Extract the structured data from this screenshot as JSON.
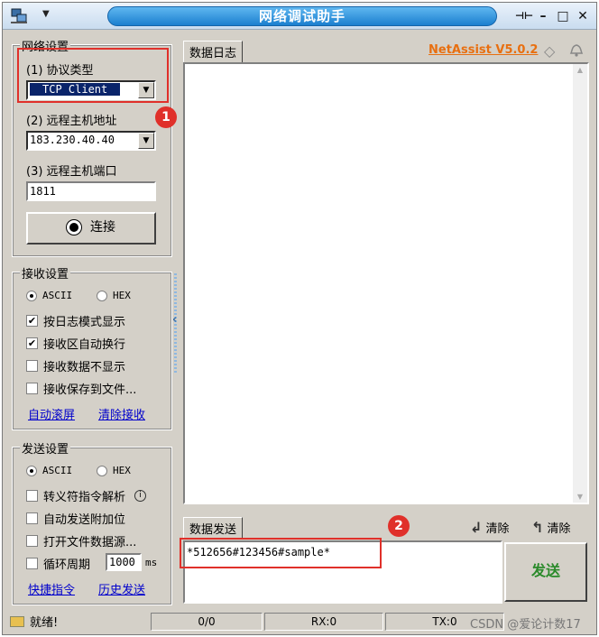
{
  "title": "网络调试助手",
  "window_controls": {
    "pin": "⊣⊢",
    "minimize": "–",
    "restore": "□",
    "close": "✕"
  },
  "network": {
    "group_title": "网络设置",
    "protocol_label": "(1) 协议类型",
    "protocol_value": "TCP Client",
    "host_label": "(2) 远程主机地址",
    "host_value": "183.230.40.40",
    "port_label": "(3) 远程主机端口",
    "port_value": "1811",
    "connect_label": "连接"
  },
  "receive": {
    "group_title": "接收设置",
    "ascii": "ASCII",
    "hex": "HEX",
    "options": [
      {
        "label": "按日志模式显示",
        "checked": "✔"
      },
      {
        "label": "接收区自动换行",
        "checked": "✔"
      },
      {
        "label": "接收数据不显示",
        "checked": ""
      },
      {
        "label": "接收保存到文件...",
        "checked": ""
      }
    ],
    "link_autoscroll": "自动滚屏",
    "link_clear": "清除接收"
  },
  "send": {
    "group_title": "发送设置",
    "ascii": "ASCII",
    "hex": "HEX",
    "options": [
      {
        "label": "转义符指令解析",
        "checked": ""
      },
      {
        "label": "自动发送附加位",
        "checked": ""
      },
      {
        "label": "打开文件数据源...",
        "checked": ""
      },
      {
        "label": "循环周期",
        "checked": ""
      }
    ],
    "cycle_value": "1000",
    "cycle_unit": "ms",
    "link_shortcut": "快捷指令",
    "link_history": "历史发送"
  },
  "log": {
    "tab_label": "数据日志",
    "brand": "NetAssist V5.0.2"
  },
  "send_area": {
    "tab_label": "数据发送",
    "clear1": "清除",
    "clear2": "清除",
    "content": "*512656#123456#sample*",
    "send_button": "发送"
  },
  "status": {
    "ready": "就绪!",
    "count": "0/0",
    "rx": "RX:0",
    "tx": "TX:0"
  },
  "watermark": "CSDN @爱论计数17",
  "annotations": {
    "badge1": "1",
    "badge2": "2"
  },
  "colors": {
    "annotation_red": "#e0302a",
    "brand_orange": "#e86f10",
    "send_green": "#2a8a2a",
    "title_blue": "#1b7fcf"
  }
}
